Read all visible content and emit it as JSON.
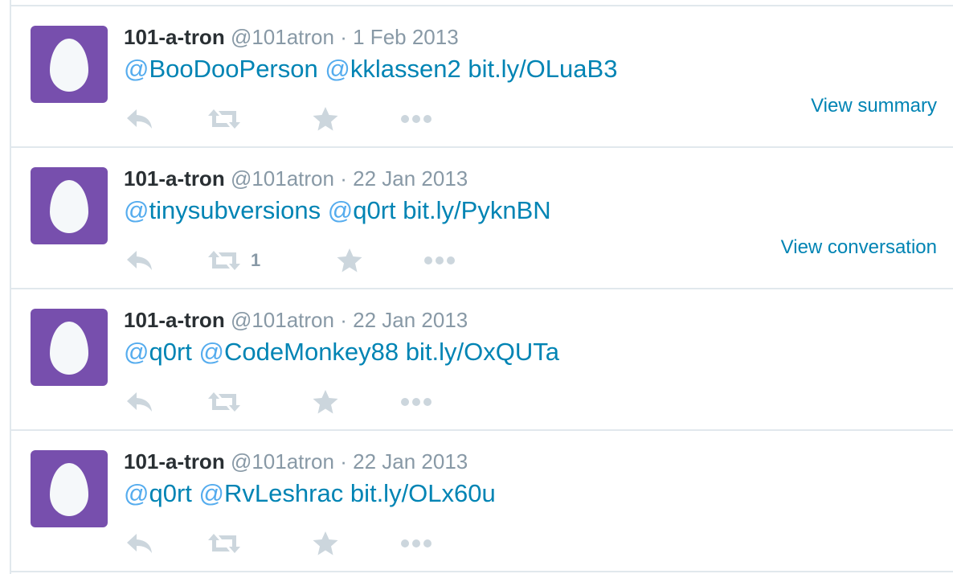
{
  "colors": {
    "avatar": "#774fad",
    "link": "#0084b4",
    "at_sign": "#55acee",
    "muted": "#8899a6",
    "icon": "#ccd6dd",
    "name": "#292f33",
    "border": "#e1e8ed"
  },
  "icons": [
    "egg-avatar",
    "reply-icon",
    "retweet-icon",
    "favorite-icon",
    "more-icon"
  ],
  "tweets": [
    {
      "fullname": "101-a-tron",
      "username": "@101atron",
      "separator": "·",
      "time": "1 Feb 2013",
      "mentions": [
        {
          "at": "@",
          "name": "BooDooPerson"
        },
        {
          "at": "@",
          "name": "kklassen2"
        }
      ],
      "link": "bit.ly/OLuaB3",
      "retweet_count": "",
      "view_label": "View summary"
    },
    {
      "fullname": "101-a-tron",
      "username": "@101atron",
      "separator": "·",
      "time": "22 Jan 2013",
      "mentions": [
        {
          "at": "@",
          "name": "tinysubversions"
        },
        {
          "at": "@",
          "name": "q0rt"
        }
      ],
      "link": "bit.ly/PyknBN",
      "retweet_count": "1",
      "view_label": "View conversation"
    },
    {
      "fullname": "101-a-tron",
      "username": "@101atron",
      "separator": "·",
      "time": "22 Jan 2013",
      "mentions": [
        {
          "at": "@",
          "name": "q0rt"
        },
        {
          "at": "@",
          "name": "CodeMonkey88"
        }
      ],
      "link": "bit.ly/OxQUTa",
      "retweet_count": "",
      "view_label": ""
    },
    {
      "fullname": "101-a-tron",
      "username": "@101atron",
      "separator": "·",
      "time": "22 Jan 2013",
      "mentions": [
        {
          "at": "@",
          "name": "q0rt"
        },
        {
          "at": "@",
          "name": "RvLeshrac"
        }
      ],
      "link": "bit.ly/OLx60u",
      "retweet_count": "",
      "view_label": ""
    }
  ]
}
